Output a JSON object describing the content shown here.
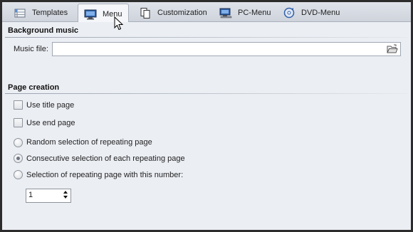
{
  "tabs": [
    {
      "label": "Templates",
      "icon": "templates-icon"
    },
    {
      "label": "Menu",
      "icon": "menu-monitor-icon",
      "active": true
    },
    {
      "label": "Customization",
      "icon": "customization-pages-icon"
    },
    {
      "label": "PC-Menu",
      "icon": "pc-menu-icon"
    },
    {
      "label": "DVD-Menu",
      "icon": "dvd-disc-icon"
    }
  ],
  "background_music": {
    "title": "Background music",
    "music_file_label": "Music file:",
    "music_file_value": ""
  },
  "page_creation": {
    "title": "Page creation",
    "use_title_page": "Use title page",
    "use_end_page": "Use end page",
    "options": [
      {
        "label": "Random selection of repeating page",
        "checked": false
      },
      {
        "label": "Consecutive selection of each repeating page",
        "checked": true
      },
      {
        "label": "Selection of repeating page with this number:",
        "checked": false
      }
    ],
    "page_number": "1"
  },
  "colors": {
    "panel": "#ebeef3",
    "frame": "#2c2c2c",
    "tabbar": "#d6dae1"
  }
}
